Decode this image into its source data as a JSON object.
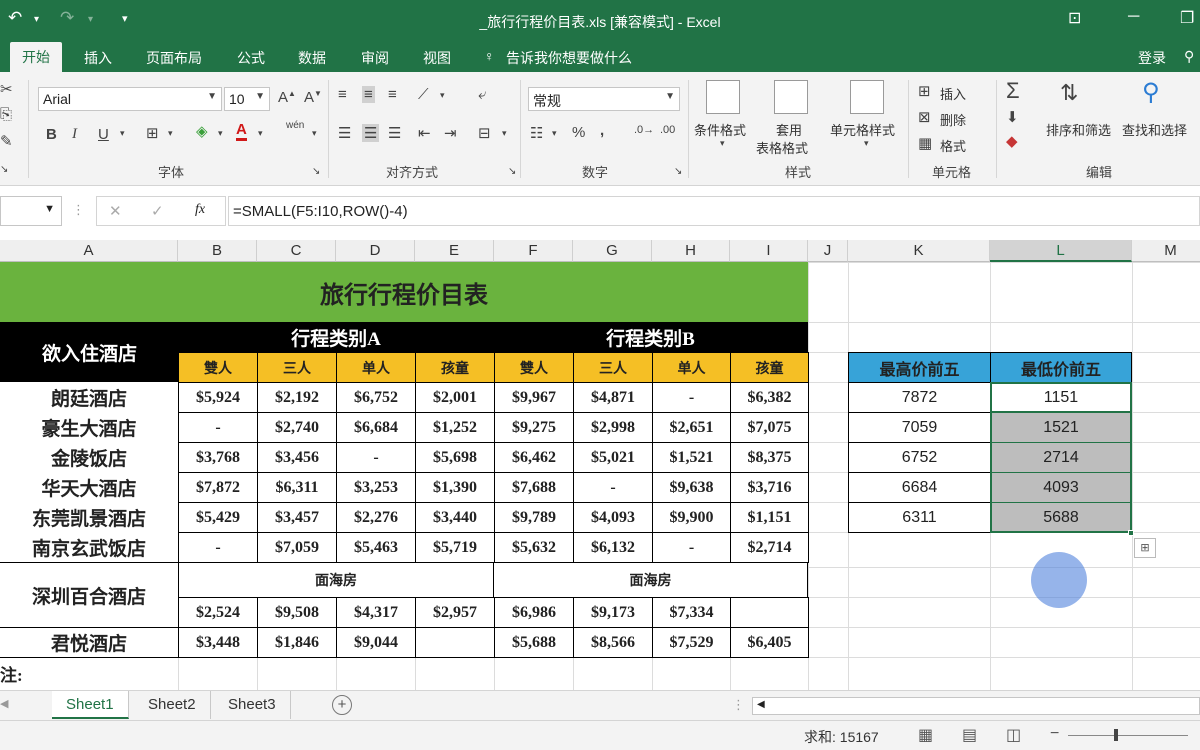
{
  "title_bar": {
    "doc_title": "_旅行行程价目表.xls  [兼容模式] - Excel",
    "undo_icon": "undo-icon",
    "redo_icon": "redo-icon"
  },
  "tabs": [
    "开始",
    "插入",
    "页面布局",
    "公式",
    "数据",
    "审阅",
    "视图"
  ],
  "tell_me": "告诉我你想要做什么",
  "login": "登录",
  "ribbon": {
    "font_name": "Arial",
    "font_size": "10",
    "number_format": "常规",
    "groups": {
      "font": "字体",
      "alignment": "对齐方式",
      "number": "数字",
      "styles": "样式",
      "cells": "单元格",
      "editing": "编辑"
    },
    "styles_buttons": {
      "conditional": "条件格式",
      "table_1": "套用",
      "table_2": "表格格式",
      "cell_styles": "单元格样式"
    },
    "cells_buttons": {
      "insert": "插入",
      "delete": "删除",
      "format": "格式"
    },
    "editing_buttons": {
      "sort": "排序和筛选",
      "find": "查找和选择"
    },
    "bold": "B",
    "italic": "I",
    "underline": "U",
    "wen": "wén"
  },
  "formula_bar": {
    "fx": "fx",
    "formula": "=SMALL(F5:I10,ROW()-4)"
  },
  "columns": [
    "A",
    "B",
    "C",
    "D",
    "E",
    "F",
    "G",
    "H",
    "I",
    "J",
    "K",
    "L",
    "M"
  ],
  "sheet": {
    "title": "旅行行程价目表",
    "header_hotel": "欲入住酒店",
    "category_a": "行程类别A",
    "category_b": "行程类别B",
    "sub_headers": [
      "雙人",
      "三人",
      "单人",
      "孩童",
      "雙人",
      "三人",
      "单人",
      "孩童"
    ],
    "rows": [
      {
        "hotel": "朗廷酒店",
        "values": [
          "$5,924",
          "$2,192",
          "$6,752",
          "$2,001",
          "$9,967",
          "$4,871",
          "-",
          "$6,382"
        ]
      },
      {
        "hotel": "豪生大酒店",
        "values": [
          "-",
          "$2,740",
          "$6,684",
          "$1,252",
          "$9,275",
          "$2,998",
          "$2,651",
          "$7,075"
        ]
      },
      {
        "hotel": "金陵饭店",
        "values": [
          "$3,768",
          "$3,456",
          "-",
          "$5,698",
          "$6,462",
          "$5,021",
          "$1,521",
          "$8,375"
        ]
      },
      {
        "hotel": "华天大酒店",
        "values": [
          "$7,872",
          "$6,311",
          "$3,253",
          "$1,390",
          "$7,688",
          "-",
          "$9,638",
          "$3,716"
        ]
      },
      {
        "hotel": "东莞凯景酒店",
        "values": [
          "$5,429",
          "$3,457",
          "$2,276",
          "$3,440",
          "$9,789",
          "$4,093",
          "$9,900",
          "$1,151"
        ]
      },
      {
        "hotel": "南京玄武饭店",
        "values": [
          "-",
          "$7,059",
          "$5,463",
          "$5,719",
          "$5,632",
          "$6,132",
          "-",
          "$2,714"
        ]
      }
    ],
    "shenzhen": {
      "hotel": "深圳百合酒店",
      "face_sea": "面海房",
      "values": [
        "$2,524",
        "$9,508",
        "$4,317",
        "$2,957",
        "$6,986",
        "$9,173",
        "$7,334",
        ""
      ]
    },
    "junyue": {
      "hotel": "君悦酒店",
      "values": [
        "$3,448",
        "$1,846",
        "$9,044",
        "",
        "$5,688",
        "$8,566",
        "$7,529",
        "$6,405"
      ]
    },
    "note": "注:"
  },
  "side_table": {
    "header_max": "最高价前五",
    "header_min": "最低价前五",
    "max": [
      "7872",
      "7059",
      "6752",
      "6684",
      "6311"
    ],
    "min": [
      "1151",
      "1521",
      "2714",
      "4093",
      "5688"
    ]
  },
  "sheet_tabs": [
    "Sheet1",
    "Sheet2",
    "Sheet3"
  ],
  "status": {
    "sum": "求和: 15167"
  },
  "colors": {
    "excel_green": "#217346",
    "title_fill": "#6ab33e",
    "header_yellow": "#f5bf25",
    "side_header_blue": "#37a3d8"
  }
}
